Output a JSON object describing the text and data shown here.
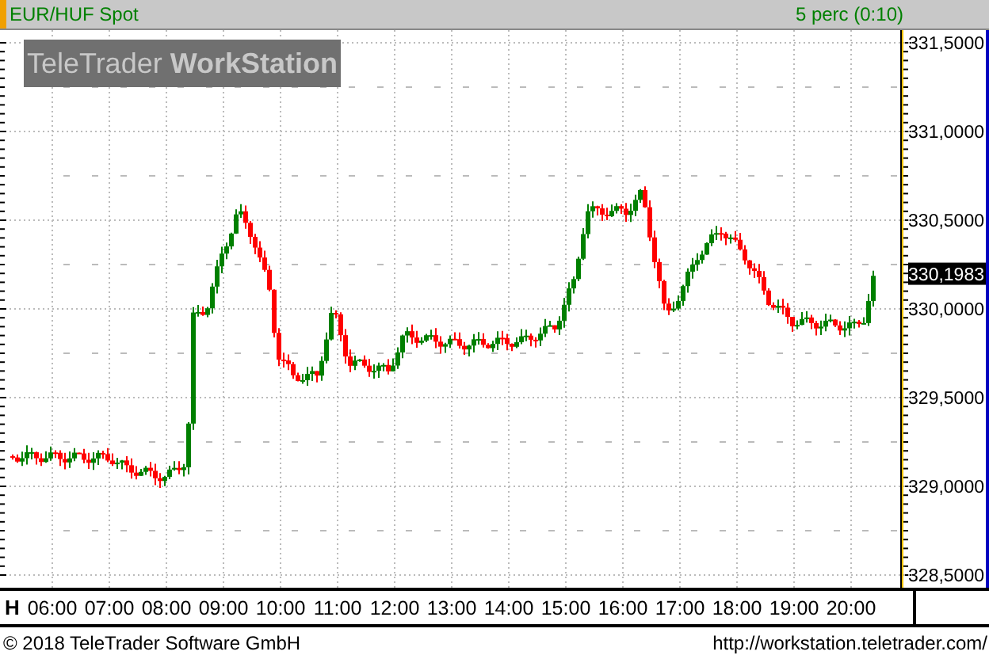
{
  "header": {
    "symbol": "EUR/HUF Spot",
    "interval": "5 perc (0:10)"
  },
  "logo": {
    "brand": "TeleTrader",
    "product": "WorkStation"
  },
  "price_axis": {
    "labels": [
      "331,5000",
      "331,0000",
      "330,5000",
      "330,0000",
      "329,5000",
      "329,0000",
      "328,5000"
    ],
    "current_price": "330,1983"
  },
  "time_axis": {
    "unit": "H",
    "labels": [
      "06:00",
      "07:00",
      "08:00",
      "09:00",
      "10:00",
      "11:00",
      "12:00",
      "13:00",
      "14:00",
      "15:00",
      "16:00",
      "17:00",
      "18:00",
      "19:00",
      "20:00"
    ]
  },
  "footer": {
    "copyright": "© 2018 TeleTrader Software GmbH",
    "url": "http://workstation.teletrader.com/"
  }
}
